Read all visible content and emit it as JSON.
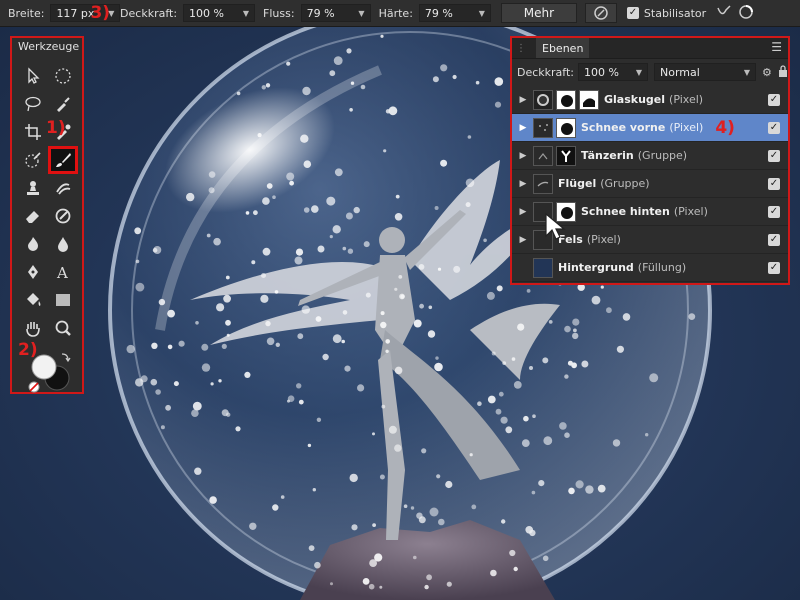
{
  "toolbar": {
    "breite_label": "Breite:",
    "breite_value": "117 px",
    "marker3": "3)",
    "deckkraft_label": "Deckkraft:",
    "deckkraft_value": "100 %",
    "fluss_label": "Fluss:",
    "fluss_value": "79 %",
    "haerte_label": "Härte:",
    "haerte_value": "79 %",
    "mehr_label": "Mehr",
    "stabilisator_label": "Stabilisator"
  },
  "tools": {
    "title": "Werkzeuge",
    "marker1": "1)",
    "marker2": "2)",
    "items": [
      "move-tool",
      "selection-brush-tool",
      "lasso-tool",
      "color-picker-tool",
      "crop-tool",
      "eyedropper-tool",
      "flood-select-tool",
      "paint-brush-tool",
      "clone-tool",
      "smudge-tool",
      "eraser-tool",
      "healing-tool",
      "dodge-tool",
      "burn-tool",
      "pen-tool",
      "text-tool",
      "fill-tool",
      "rectangle-tool",
      "hand-tool",
      "zoom-tool"
    ],
    "selected": "paint-brush-tool"
  },
  "layers": {
    "tab": "Ebenen",
    "deckkraft_label": "Deckkraft:",
    "deckkraft_value": "100 %",
    "blend_mode": "Normal",
    "marker4": "4)",
    "items": [
      {
        "name": "Glaskugel",
        "type": "(Pixel)"
      },
      {
        "name": "Schnee vorne",
        "type": "(Pixel)"
      },
      {
        "name": "Tänzerin",
        "type": "(Gruppe)"
      },
      {
        "name": "Flügel",
        "type": "(Gruppe)"
      },
      {
        "name": "Schnee hinten",
        "type": "(Pixel)"
      },
      {
        "name": "Fels",
        "type": "(Pixel)"
      },
      {
        "name": "Hintergrund",
        "type": "(Füllung)"
      }
    ],
    "selected_index": 1
  },
  "colors": {
    "accent_red": "#e01010",
    "selection_blue": "#5f86c9",
    "background_navy": "#223556"
  }
}
